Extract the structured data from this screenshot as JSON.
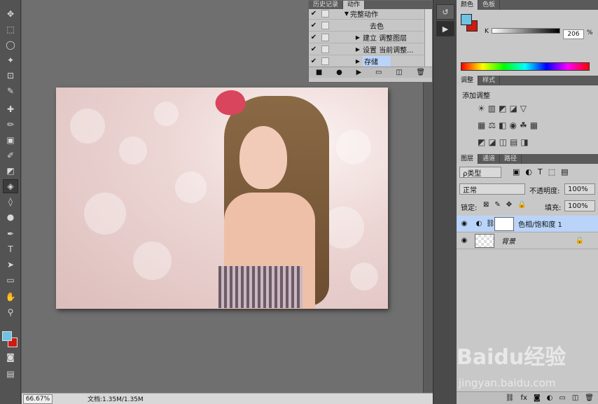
{
  "toolbar": {
    "tools": [
      "move",
      "marquee",
      "lasso",
      "quick-select",
      "crop",
      "eyedropper",
      "healing",
      "brush",
      "stamp",
      "history-brush",
      "eraser",
      "paint-bucket",
      "blur",
      "dodge",
      "pen",
      "type",
      "path-select",
      "shape",
      "hand",
      "zoom"
    ],
    "foreground_color": "#6ec3e3",
    "background_color": "#cc1b10"
  },
  "actions_panel": {
    "tabs": [
      "历史记录",
      "动作"
    ],
    "active_tab": "动作",
    "items": [
      {
        "label": "完整动作",
        "checked": true,
        "expanded": true
      },
      {
        "label": "去色",
        "checked": true
      },
      {
        "label": "建立 调整图层",
        "checked": true,
        "expandable": true
      },
      {
        "label": "设置 当前调整...",
        "checked": true,
        "expandable": true
      },
      {
        "label": "存储",
        "checked": true,
        "expandable": true,
        "selected": true
      }
    ],
    "footer_icons": [
      "stop",
      "record",
      "play",
      "new-set",
      "new-action",
      "delete"
    ]
  },
  "status": {
    "zoom": "66.67%",
    "doc_size": "文档:1.35M/1.35M"
  },
  "color_panel": {
    "tabs": [
      "颜色",
      "色板"
    ],
    "channel_label": "K",
    "value": "206",
    "fg": "#6ec3e3",
    "bg": "#cc1b10"
  },
  "adjust_panel": {
    "tabs": [
      "调整",
      "样式"
    ],
    "title": "添加调整"
  },
  "layers_panel": {
    "tabs": [
      "图层",
      "通道",
      "路径"
    ],
    "filter_label": "ρ类型",
    "blend_mode": "正常",
    "opacity_label": "不透明度:",
    "opacity_value": "100%",
    "lock_label": "锁定:",
    "fill_label": "填充:",
    "fill_value": "100%",
    "layers": [
      {
        "name": "色相/饱和度 1",
        "selected": true
      },
      {
        "name": "背景",
        "locked": true
      }
    ],
    "footer_icons": [
      "link",
      "fx",
      "mask",
      "adjustment",
      "group",
      "new",
      "delete"
    ]
  },
  "watermark": {
    "brand": "Baidu经验",
    "url": "jingyan.baidu.com"
  }
}
